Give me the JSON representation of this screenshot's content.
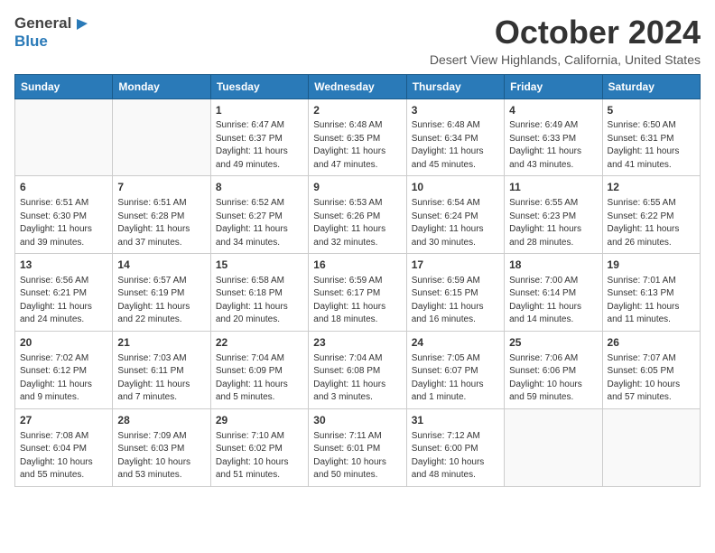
{
  "header": {
    "logo_general": "General",
    "logo_blue": "Blue",
    "month": "October 2024",
    "location": "Desert View Highlands, California, United States"
  },
  "weekdays": [
    "Sunday",
    "Monday",
    "Tuesday",
    "Wednesday",
    "Thursday",
    "Friday",
    "Saturday"
  ],
  "weeks": [
    [
      {
        "day": null,
        "info": ""
      },
      {
        "day": null,
        "info": ""
      },
      {
        "day": "1",
        "info": "Sunrise: 6:47 AM\nSunset: 6:37 PM\nDaylight: 11 hours and 49 minutes."
      },
      {
        "day": "2",
        "info": "Sunrise: 6:48 AM\nSunset: 6:35 PM\nDaylight: 11 hours and 47 minutes."
      },
      {
        "day": "3",
        "info": "Sunrise: 6:48 AM\nSunset: 6:34 PM\nDaylight: 11 hours and 45 minutes."
      },
      {
        "day": "4",
        "info": "Sunrise: 6:49 AM\nSunset: 6:33 PM\nDaylight: 11 hours and 43 minutes."
      },
      {
        "day": "5",
        "info": "Sunrise: 6:50 AM\nSunset: 6:31 PM\nDaylight: 11 hours and 41 minutes."
      }
    ],
    [
      {
        "day": "6",
        "info": "Sunrise: 6:51 AM\nSunset: 6:30 PM\nDaylight: 11 hours and 39 minutes."
      },
      {
        "day": "7",
        "info": "Sunrise: 6:51 AM\nSunset: 6:28 PM\nDaylight: 11 hours and 37 minutes."
      },
      {
        "day": "8",
        "info": "Sunrise: 6:52 AM\nSunset: 6:27 PM\nDaylight: 11 hours and 34 minutes."
      },
      {
        "day": "9",
        "info": "Sunrise: 6:53 AM\nSunset: 6:26 PM\nDaylight: 11 hours and 32 minutes."
      },
      {
        "day": "10",
        "info": "Sunrise: 6:54 AM\nSunset: 6:24 PM\nDaylight: 11 hours and 30 minutes."
      },
      {
        "day": "11",
        "info": "Sunrise: 6:55 AM\nSunset: 6:23 PM\nDaylight: 11 hours and 28 minutes."
      },
      {
        "day": "12",
        "info": "Sunrise: 6:55 AM\nSunset: 6:22 PM\nDaylight: 11 hours and 26 minutes."
      }
    ],
    [
      {
        "day": "13",
        "info": "Sunrise: 6:56 AM\nSunset: 6:21 PM\nDaylight: 11 hours and 24 minutes."
      },
      {
        "day": "14",
        "info": "Sunrise: 6:57 AM\nSunset: 6:19 PM\nDaylight: 11 hours and 22 minutes."
      },
      {
        "day": "15",
        "info": "Sunrise: 6:58 AM\nSunset: 6:18 PM\nDaylight: 11 hours and 20 minutes."
      },
      {
        "day": "16",
        "info": "Sunrise: 6:59 AM\nSunset: 6:17 PM\nDaylight: 11 hours and 18 minutes."
      },
      {
        "day": "17",
        "info": "Sunrise: 6:59 AM\nSunset: 6:15 PM\nDaylight: 11 hours and 16 minutes."
      },
      {
        "day": "18",
        "info": "Sunrise: 7:00 AM\nSunset: 6:14 PM\nDaylight: 11 hours and 14 minutes."
      },
      {
        "day": "19",
        "info": "Sunrise: 7:01 AM\nSunset: 6:13 PM\nDaylight: 11 hours and 11 minutes."
      }
    ],
    [
      {
        "day": "20",
        "info": "Sunrise: 7:02 AM\nSunset: 6:12 PM\nDaylight: 11 hours and 9 minutes."
      },
      {
        "day": "21",
        "info": "Sunrise: 7:03 AM\nSunset: 6:11 PM\nDaylight: 11 hours and 7 minutes."
      },
      {
        "day": "22",
        "info": "Sunrise: 7:04 AM\nSunset: 6:09 PM\nDaylight: 11 hours and 5 minutes."
      },
      {
        "day": "23",
        "info": "Sunrise: 7:04 AM\nSunset: 6:08 PM\nDaylight: 11 hours and 3 minutes."
      },
      {
        "day": "24",
        "info": "Sunrise: 7:05 AM\nSunset: 6:07 PM\nDaylight: 11 hours and 1 minute."
      },
      {
        "day": "25",
        "info": "Sunrise: 7:06 AM\nSunset: 6:06 PM\nDaylight: 10 hours and 59 minutes."
      },
      {
        "day": "26",
        "info": "Sunrise: 7:07 AM\nSunset: 6:05 PM\nDaylight: 10 hours and 57 minutes."
      }
    ],
    [
      {
        "day": "27",
        "info": "Sunrise: 7:08 AM\nSunset: 6:04 PM\nDaylight: 10 hours and 55 minutes."
      },
      {
        "day": "28",
        "info": "Sunrise: 7:09 AM\nSunset: 6:03 PM\nDaylight: 10 hours and 53 minutes."
      },
      {
        "day": "29",
        "info": "Sunrise: 7:10 AM\nSunset: 6:02 PM\nDaylight: 10 hours and 51 minutes."
      },
      {
        "day": "30",
        "info": "Sunrise: 7:11 AM\nSunset: 6:01 PM\nDaylight: 10 hours and 50 minutes."
      },
      {
        "day": "31",
        "info": "Sunrise: 7:12 AM\nSunset: 6:00 PM\nDaylight: 10 hours and 48 minutes."
      },
      {
        "day": null,
        "info": ""
      },
      {
        "day": null,
        "info": ""
      }
    ]
  ]
}
